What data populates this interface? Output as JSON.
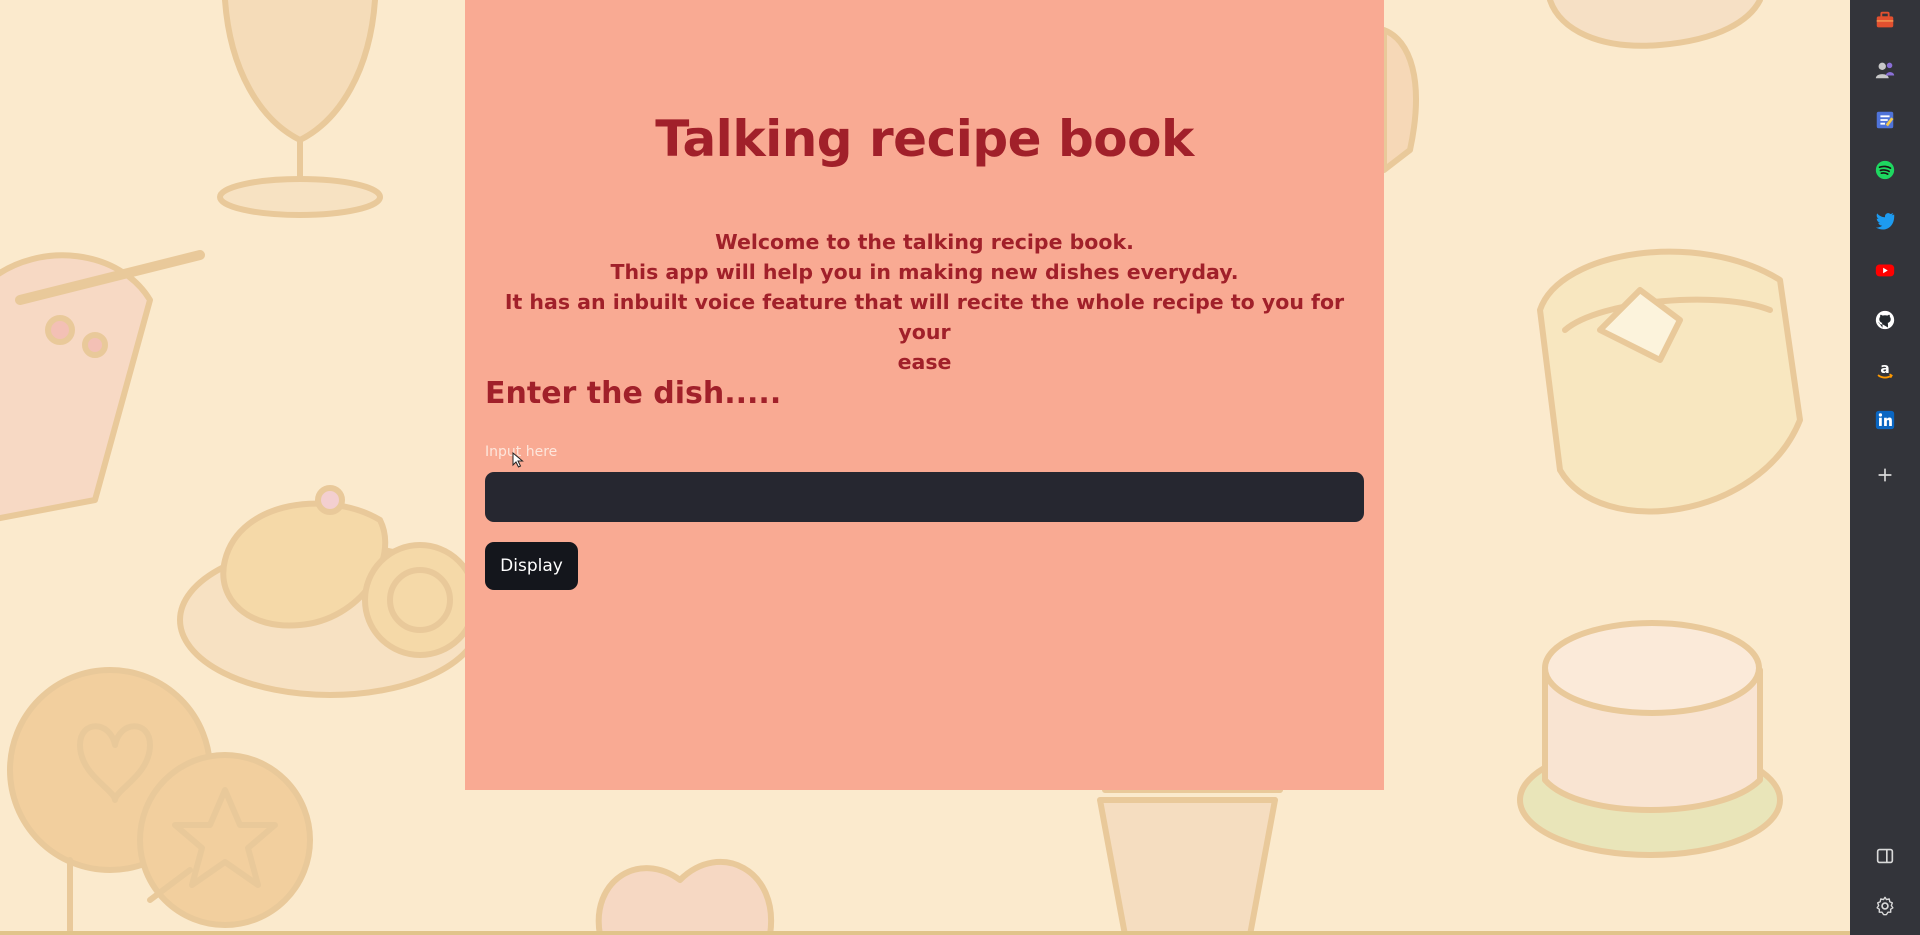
{
  "app": {
    "title": "Talking recipe book",
    "intro_lines": [
      "Welcome to the talking recipe book.",
      "This app will help you in making new dishes everyday.",
      "It has an inbuilt voice feature that will recite the whole recipe to you for your",
      "ease"
    ],
    "subheading": "Enter the dish.....",
    "input": {
      "label": "Input here",
      "value": "",
      "placeholder": ""
    },
    "button_label": "Display"
  },
  "colors": {
    "page_background": "#fbeacd",
    "panel_background": "#f9aa93",
    "heading_text": "#a1202a",
    "input_background": "#262730",
    "button_background": "#14161c",
    "sidebar_background": "#33343a"
  },
  "sidebar": {
    "icons": [
      "briefcase-icon",
      "users-icon",
      "notepad-icon",
      "spotify-icon",
      "twitter-icon",
      "youtube-icon",
      "github-icon",
      "amazon-icon",
      "linkedin-icon",
      "add-icon",
      "sidebar-toggle-icon",
      "gear-icon"
    ]
  }
}
